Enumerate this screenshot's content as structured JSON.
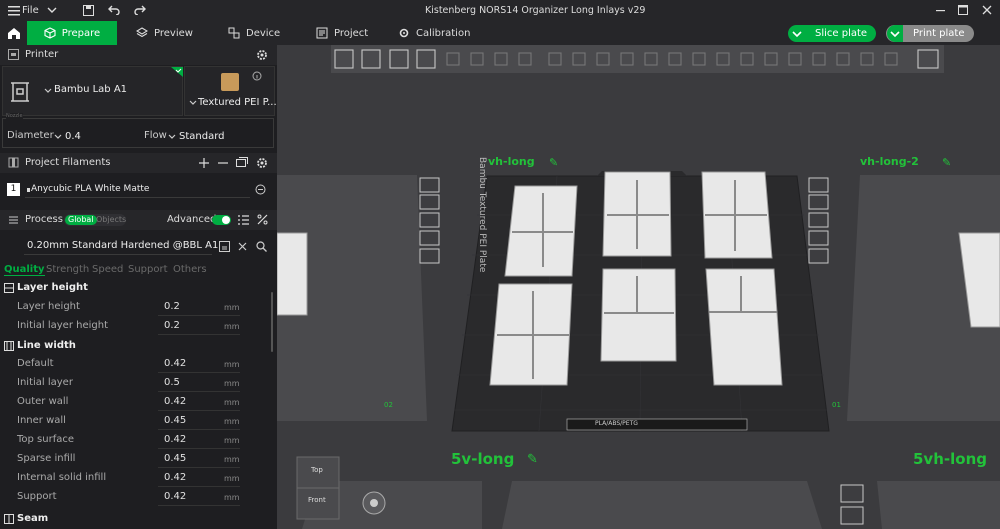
{
  "titlebar": {
    "file_label": "File",
    "window_title": "Kistenberg NORS14 Organizer Long Inlays v29"
  },
  "tabs": {
    "prepare": "Prepare",
    "preview": "Preview",
    "device": "Device",
    "project": "Project",
    "calibration": "Calibration"
  },
  "actions": {
    "slice": "Slice plate",
    "print": "Print plate"
  },
  "printer": {
    "section_title": "Printer",
    "name": "Bambu Lab A1",
    "plate": "Textured PEI P...",
    "nozzle_caption": "Nozzle",
    "diameter_label": "Diameter",
    "diameter_value": "0.4",
    "flow_label": "Flow",
    "flow_value": "Standard"
  },
  "filaments": {
    "section_title": "Project Filaments",
    "items": [
      {
        "index": "1",
        "name": "Anycubic PLA White Matte",
        "color": "#ffffff"
      }
    ]
  },
  "process": {
    "section_title": "Process",
    "toggle_global": "Global",
    "toggle_objects": "Objects",
    "advanced_label": "Advanced",
    "preset": "0.20mm Standard Hardened @BBL A1",
    "tabs": [
      "Quality",
      "Strength",
      "Speed",
      "Support",
      "Others"
    ],
    "groups": {
      "layer_height": {
        "title": "Layer height",
        "rows": [
          {
            "label": "Layer height",
            "value": "0.2",
            "unit": "mm"
          },
          {
            "label": "Initial layer height",
            "value": "0.2",
            "unit": "mm"
          }
        ]
      },
      "line_width": {
        "title": "Line width",
        "rows": [
          {
            "label": "Default",
            "value": "0.42",
            "unit": "mm"
          },
          {
            "label": "Initial layer",
            "value": "0.5",
            "unit": "mm"
          },
          {
            "label": "Outer wall",
            "value": "0.42",
            "unit": "mm"
          },
          {
            "label": "Inner wall",
            "value": "0.45",
            "unit": "mm"
          },
          {
            "label": "Top surface",
            "value": "0.42",
            "unit": "mm"
          },
          {
            "label": "Sparse infill",
            "value": "0.45",
            "unit": "mm"
          },
          {
            "label": "Internal solid infill",
            "value": "0.42",
            "unit": "mm"
          },
          {
            "label": "Support",
            "value": "0.42",
            "unit": "mm"
          }
        ]
      },
      "seam": {
        "title": "Seam"
      }
    }
  },
  "viewport": {
    "plate_names": {
      "left": "vh-long",
      "right": "vh-long-2",
      "bottom_left": "5v-long",
      "bottom_right": "5vh-long"
    },
    "bed_label": "Bambu Textured PEI Plate",
    "bed_material": "PLA/ABS/PETG",
    "bed_corner_left": "02",
    "bed_corner_right": "01",
    "view_cube_top": "Top",
    "view_cube_front": "Front",
    "colors": {
      "accent": "#00ae42",
      "plate_label": "#22c23a"
    }
  }
}
